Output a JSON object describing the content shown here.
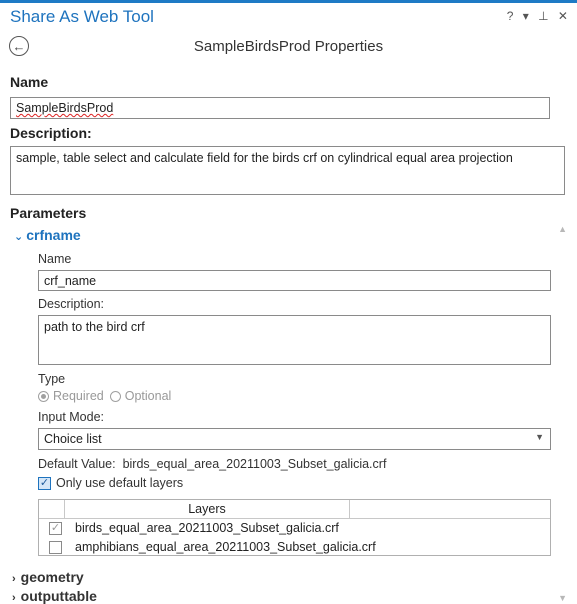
{
  "pane": {
    "title": "Share As Web Tool",
    "controls": "? ▾ ⊥ ✕"
  },
  "header": {
    "back_icon": "back-arrow-icon",
    "title": "SampleBirdsProd Properties"
  },
  "name_section": {
    "label": "Name",
    "value": "SampleBirdsProd"
  },
  "description_section": {
    "label": "Description:",
    "value": "sample, table select and calculate field for the birds crf on cylindrical equal area projection"
  },
  "parameters": {
    "label": "Parameters",
    "expanded": {
      "name": "crfname",
      "name_label": "Name",
      "name_value": "crf_name",
      "description_label": "Description:",
      "description_value": "path to the bird crf",
      "type_label": "Type",
      "type_required": "Required",
      "type_optional": "Optional",
      "input_mode_label": "Input Mode:",
      "input_mode_value": "Choice list",
      "default_value_label": "Default Value:",
      "default_value": "birds_equal_area_20211003_Subset_galicia.crf",
      "only_default_layers_label": "Only use default layers",
      "layers_header": "Layers",
      "layers": [
        {
          "name": "birds_equal_area_20211003_Subset_galicia.crf",
          "checked": true
        },
        {
          "name": "amphibians_equal_area_20211003_Subset_galicia.crf",
          "checked": false
        }
      ]
    },
    "collapsed": [
      "geometry",
      "outputtable"
    ]
  },
  "colors": {
    "accent": "#1e73be",
    "topbar": "#1e7ac5"
  }
}
